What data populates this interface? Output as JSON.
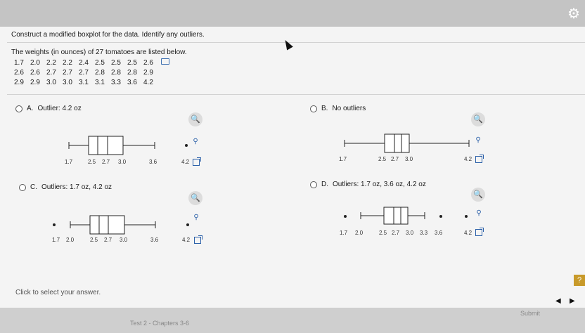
{
  "instruction": "Construct a modified boxplot for the data. Identify any outliers.",
  "intro": "The weights (in ounces) of 27 tomatoes are listed below.",
  "data_rows": [
    [
      "1.7",
      "2.0",
      "2.2",
      "2.2",
      "2.4",
      "2.5",
      "2.5",
      "2.5",
      "2.6"
    ],
    [
      "2.6",
      "2.6",
      "2.7",
      "2.7",
      "2.7",
      "2.8",
      "2.8",
      "2.8",
      "2.9"
    ],
    [
      "2.9",
      "2.9",
      "3.0",
      "3.0",
      "3.1",
      "3.1",
      "3.3",
      "3.6",
      "4.2"
    ]
  ],
  "options": {
    "a": {
      "letter": "A.",
      "text": "Outlier: 4.2 oz"
    },
    "b": {
      "letter": "B.",
      "text": "No outliers"
    },
    "c": {
      "letter": "C.",
      "text": "Outliers: 1.7 oz, 4.2 oz"
    },
    "d": {
      "letter": "D.",
      "text": "Outliers: 1.7 oz, 3.6 oz, 4.2 oz"
    }
  },
  "plot_ticks": {
    "a": [
      "1.7",
      "2.5",
      "2.7",
      "3.0",
      "3.6",
      "4.2"
    ],
    "b": [
      "1.7",
      "2.5",
      "2.7",
      "3.0",
      "4.2"
    ],
    "c": [
      "1.7",
      "2.0",
      "2.5",
      "2.7",
      "3.0",
      "3.6",
      "4.2"
    ],
    "d": [
      "1.7",
      "2.0",
      "2.5",
      "2.7",
      "3.0",
      "3.3",
      "3.6",
      "4.2"
    ]
  },
  "click_prompt": "Click to select your answer.",
  "help_label": "?",
  "nav_bottom": "Test 2 - Chapters 3-6",
  "nav_right": "Submit",
  "icons": {
    "zoom": "magnifier-icon",
    "external": "external-link-icon",
    "settings": "gear-icon",
    "copy": "copy-icon"
  }
}
